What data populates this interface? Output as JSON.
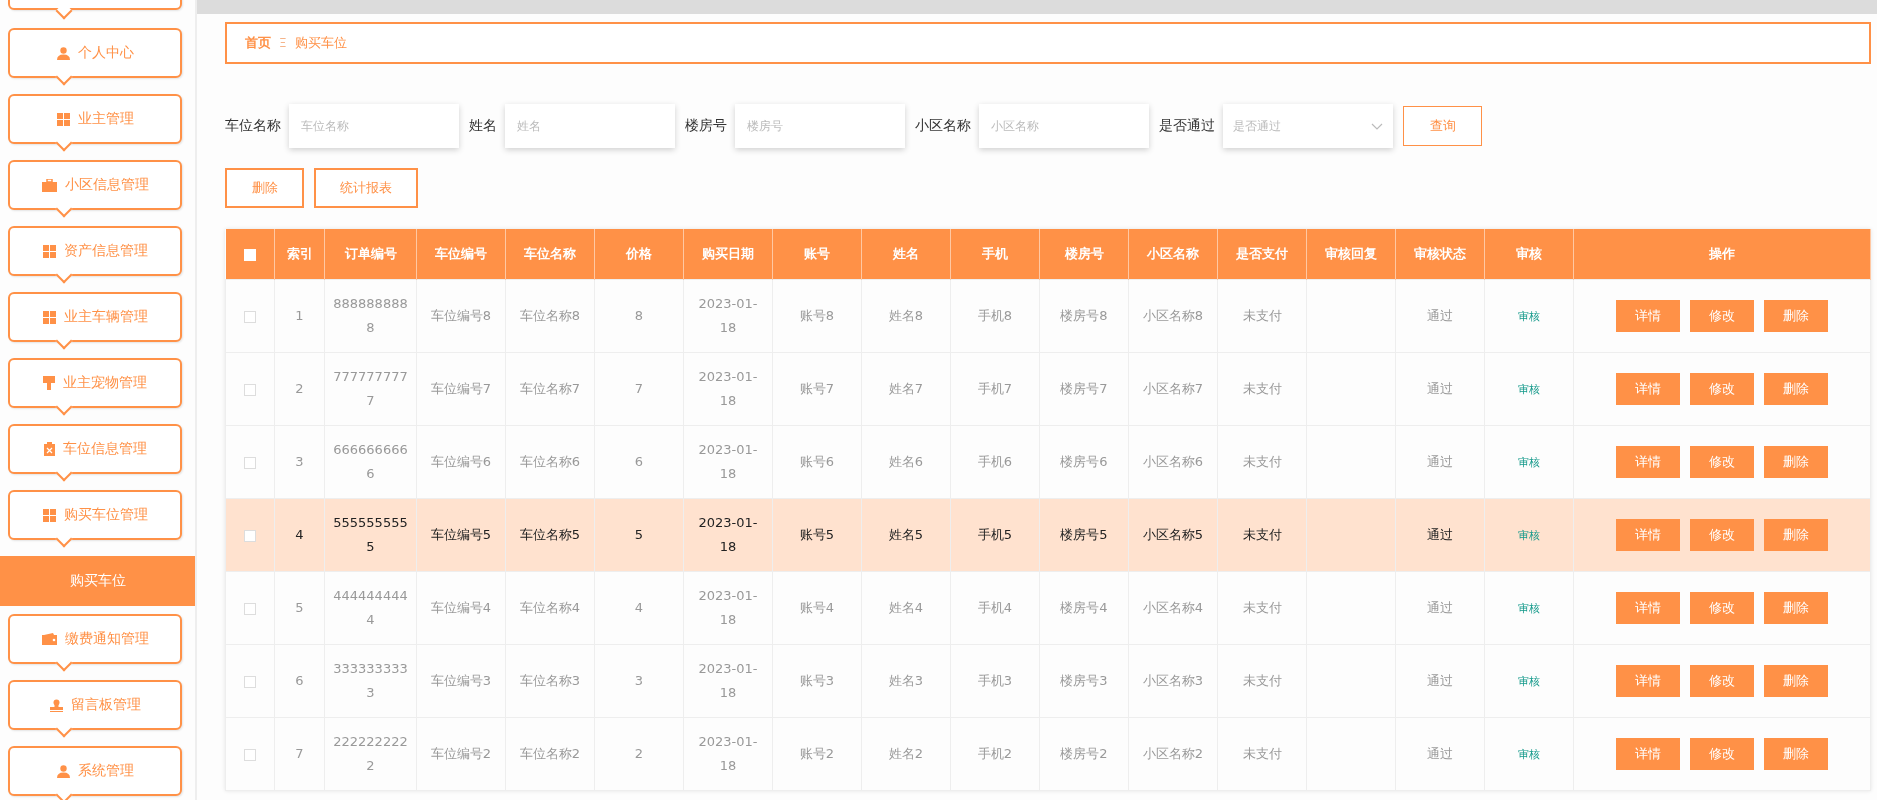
{
  "sidebar": {
    "items": [
      {
        "label": "个人中心",
        "selected": false
      },
      {
        "label": "业主管理",
        "selected": false
      },
      {
        "label": "小区信息管理",
        "selected": false
      },
      {
        "label": "资产信息管理",
        "selected": false
      },
      {
        "label": "业主车辆管理",
        "selected": false
      },
      {
        "label": "业主宠物管理",
        "selected": false
      },
      {
        "label": "车位信息管理",
        "selected": false
      },
      {
        "label": "购买车位管理",
        "selected": false,
        "children": [
          {
            "label": "购买车位",
            "selected": true
          }
        ]
      },
      {
        "label": "缴费通知管理",
        "selected": false
      },
      {
        "label": "留言板管理",
        "selected": false
      },
      {
        "label": "系统管理",
        "selected": false
      }
    ]
  },
  "breadcrumb": {
    "items": [
      "首页",
      "购买车位"
    ],
    "separator": "Ξ"
  },
  "filters": [
    {
      "kind": "text",
      "label": "车位名称",
      "placeholder": "车位名称"
    },
    {
      "kind": "text",
      "label": "姓名",
      "placeholder": "姓名"
    },
    {
      "kind": "text",
      "label": "楼房号",
      "placeholder": "楼房号"
    },
    {
      "kind": "text",
      "label": "小区名称",
      "placeholder": "小区名称"
    },
    {
      "kind": "select",
      "label": "是否通过",
      "placeholder": "是否通过"
    }
  ],
  "search_button": "查询",
  "actions": [
    "删除",
    "统计报表"
  ],
  "table": {
    "all_checked": false,
    "columns": [
      "索引",
      "订单编号",
      "车位编号",
      "车位名称",
      "价格",
      "购买日期",
      "账号",
      "姓名",
      "手机",
      "楼房号",
      "小区名称",
      "是否支付",
      "审核回复",
      "审核状态",
      "审核",
      "操作"
    ],
    "rows": [
      {
        "checked": false,
        "highlighted": false,
        "cells": [
          "1",
          "8888888888",
          "车位编号8",
          "车位名称8",
          "8",
          "2023-01-18",
          "账号8",
          "姓名8",
          "手机8",
          "楼房号8",
          "小区名称8",
          "未支付",
          "",
          "通过"
        ],
        "audit": "审核",
        "buttons": [
          "详情",
          "修改",
          "删除"
        ]
      },
      {
        "checked": false,
        "highlighted": false,
        "cells": [
          "2",
          "7777777777",
          "车位编号7",
          "车位名称7",
          "7",
          "2023-01-18",
          "账号7",
          "姓名7",
          "手机7",
          "楼房号7",
          "小区名称7",
          "未支付",
          "",
          "通过"
        ],
        "audit": "审核",
        "buttons": [
          "详情",
          "修改",
          "删除"
        ]
      },
      {
        "checked": false,
        "highlighted": false,
        "cells": [
          "3",
          "6666666666",
          "车位编号6",
          "车位名称6",
          "6",
          "2023-01-18",
          "账号6",
          "姓名6",
          "手机6",
          "楼房号6",
          "小区名称6",
          "未支付",
          "",
          "通过"
        ],
        "audit": "审核",
        "buttons": [
          "详情",
          "修改",
          "删除"
        ]
      },
      {
        "checked": false,
        "highlighted": true,
        "cells": [
          "4",
          "5555555555",
          "车位编号5",
          "车位名称5",
          "5",
          "2023-01-18",
          "账号5",
          "姓名5",
          "手机5",
          "楼房号5",
          "小区名称5",
          "未支付",
          "",
          "通过"
        ],
        "audit": "审核",
        "buttons": [
          "详情",
          "修改",
          "删除"
        ]
      },
      {
        "checked": false,
        "highlighted": false,
        "cells": [
          "5",
          "4444444444",
          "车位编号4",
          "车位名称4",
          "4",
          "2023-01-18",
          "账号4",
          "姓名4",
          "手机4",
          "楼房号4",
          "小区名称4",
          "未支付",
          "",
          "通过"
        ],
        "audit": "审核",
        "buttons": [
          "详情",
          "修改",
          "删除"
        ]
      },
      {
        "checked": false,
        "highlighted": false,
        "cells": [
          "6",
          "3333333333",
          "车位编号3",
          "车位名称3",
          "3",
          "2023-01-18",
          "账号3",
          "姓名3",
          "手机3",
          "楼房号3",
          "小区名称3",
          "未支付",
          "",
          "通过"
        ],
        "audit": "审核",
        "buttons": [
          "详情",
          "修改",
          "删除"
        ]
      },
      {
        "checked": false,
        "highlighted": false,
        "cells": [
          "7",
          "2222222222",
          "车位编号2",
          "车位名称2",
          "2",
          "2023-01-18",
          "账号2",
          "姓名2",
          "手机2",
          "楼房号2",
          "小区名称2",
          "未支付",
          "",
          "通过"
        ],
        "audit": "审核",
        "buttons": [
          "详情",
          "修改",
          "删除"
        ]
      }
    ]
  }
}
